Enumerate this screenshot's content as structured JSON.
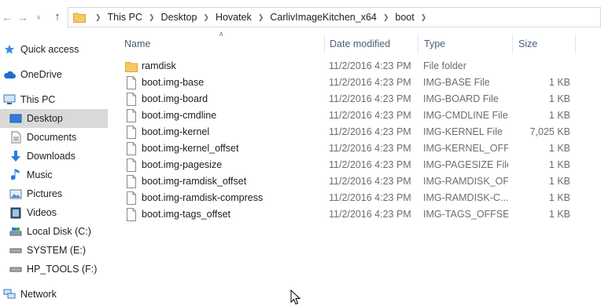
{
  "address_bar": {
    "breadcrumbs": [
      "This PC",
      "Desktop",
      "Hovatek",
      "CarlivImageKitchen_x64",
      "boot"
    ]
  },
  "nav_pane": {
    "items": [
      {
        "label": "Quick access",
        "icon": "star-icon"
      },
      {
        "label": "OneDrive",
        "icon": "cloud-icon"
      },
      {
        "label": "This PC",
        "icon": "computer-icon"
      },
      {
        "label": "Desktop",
        "icon": "desktop-icon",
        "selected": true
      },
      {
        "label": "Documents",
        "icon": "documents-icon"
      },
      {
        "label": "Downloads",
        "icon": "download-arrow-icon"
      },
      {
        "label": "Music",
        "icon": "music-note-icon"
      },
      {
        "label": "Pictures",
        "icon": "pictures-icon"
      },
      {
        "label": "Videos",
        "icon": "videos-icon"
      },
      {
        "label": "Local Disk (C:)",
        "icon": "local-disk-icon"
      },
      {
        "label": "SYSTEM (E:)",
        "icon": "drive-icon"
      },
      {
        "label": "HP_TOOLS (F:)",
        "icon": "drive-icon"
      },
      {
        "label": "Network",
        "icon": "network-icon"
      }
    ]
  },
  "columns": {
    "name": "Name",
    "date": "Date modified",
    "type": "Type",
    "size": "Size"
  },
  "files": [
    {
      "name": "ramdisk",
      "date": "11/2/2016 4:23 PM",
      "type": "File folder",
      "size": "",
      "icon": "folder-icon"
    },
    {
      "name": "boot.img-base",
      "date": "11/2/2016 4:23 PM",
      "type": "IMG-BASE File",
      "size": "1 KB",
      "icon": "file-icon"
    },
    {
      "name": "boot.img-board",
      "date": "11/2/2016 4:23 PM",
      "type": "IMG-BOARD File",
      "size": "1 KB",
      "icon": "file-icon"
    },
    {
      "name": "boot.img-cmdline",
      "date": "11/2/2016 4:23 PM",
      "type": "IMG-CMDLINE File",
      "size": "1 KB",
      "icon": "file-icon"
    },
    {
      "name": "boot.img-kernel",
      "date": "11/2/2016 4:23 PM",
      "type": "IMG-KERNEL File",
      "size": "7,025 KB",
      "icon": "file-icon"
    },
    {
      "name": "boot.img-kernel_offset",
      "date": "11/2/2016 4:23 PM",
      "type": "IMG-KERNEL_OFF...",
      "size": "1 KB",
      "icon": "file-icon"
    },
    {
      "name": "boot.img-pagesize",
      "date": "11/2/2016 4:23 PM",
      "type": "IMG-PAGESIZE File",
      "size": "1 KB",
      "icon": "file-icon"
    },
    {
      "name": "boot.img-ramdisk_offset",
      "date": "11/2/2016 4:23 PM",
      "type": "IMG-RAMDISK_OF...",
      "size": "1 KB",
      "icon": "file-icon"
    },
    {
      "name": "boot.img-ramdisk-compress",
      "date": "11/2/2016 4:23 PM",
      "type": "IMG-RAMDISK-C...",
      "size": "1 KB",
      "icon": "file-icon"
    },
    {
      "name": "boot.img-tags_offset",
      "date": "11/2/2016 4:23 PM",
      "type": "IMG-TAGS_OFFSE...",
      "size": "1 KB",
      "icon": "file-icon"
    }
  ],
  "colors": {
    "selection": "#d9d9d9",
    "header_text": "#4c607a",
    "folder_yellow": "#f6c85f"
  }
}
